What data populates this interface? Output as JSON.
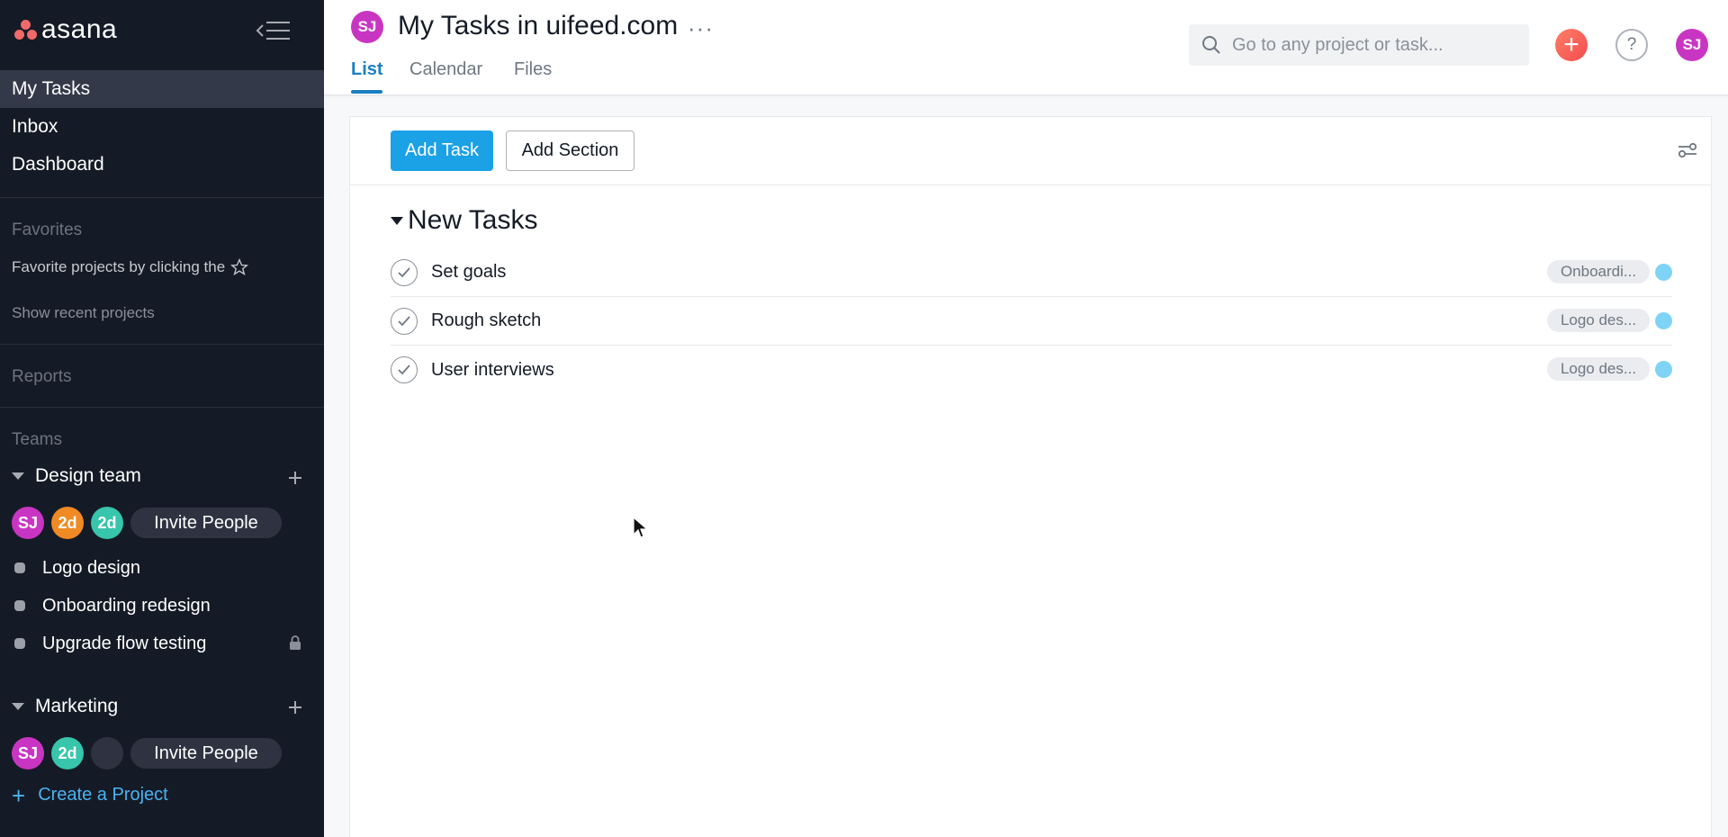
{
  "app": {
    "logo_text": "asana"
  },
  "sidebar": {
    "nav": [
      {
        "label": "My Tasks",
        "active": true
      },
      {
        "label": "Inbox"
      },
      {
        "label": "Dashboard"
      }
    ],
    "favorites_heading": "Favorites",
    "favorites_hint": "Favorite projects by clicking the",
    "show_recent": "Show recent projects",
    "reports_heading": "Reports",
    "teams_heading": "Teams",
    "teams": [
      {
        "name": "Design team",
        "members": [
          {
            "initials": "SJ",
            "color": "#c935c3"
          },
          {
            "initials": "2d",
            "color": "#f08a24"
          },
          {
            "initials": "2d",
            "color": "#37c5ab"
          }
        ],
        "invite_label": "Invite People",
        "projects": [
          {
            "name": "Logo design",
            "locked": false
          },
          {
            "name": "Onboarding redesign",
            "locked": false
          },
          {
            "name": "Upgrade flow testing",
            "locked": true
          }
        ]
      },
      {
        "name": "Marketing",
        "members": [
          {
            "initials": "SJ",
            "color": "#c935c3"
          },
          {
            "initials": "2d",
            "color": "#37c5ab"
          },
          {
            "initials": "",
            "color": "#2f3341"
          }
        ],
        "invite_label": "Invite People",
        "projects": []
      }
    ],
    "create_project": "Create a Project"
  },
  "header": {
    "avatar_initials": "SJ",
    "title": "My Tasks in uifeed.com",
    "more": "···",
    "tabs": [
      {
        "label": "List",
        "active": true
      },
      {
        "label": "Calendar"
      },
      {
        "label": "Files"
      }
    ],
    "search_placeholder": "Go to any project or task...",
    "add_symbol": "+",
    "help_symbol": "?",
    "user_initials": "SJ"
  },
  "toolbar": {
    "add_task": "Add Task",
    "add_section": "Add Section"
  },
  "section": {
    "title": "New Tasks",
    "tasks": [
      {
        "name": "Set goals",
        "project": "Onboardi...",
        "project_color": "#7ed3f6"
      },
      {
        "name": "Rough sketch",
        "project": "Logo des...",
        "project_color": "#7ed3f6"
      },
      {
        "name": "User interviews",
        "project": "Logo des...",
        "project_color": "#7ed3f6"
      }
    ]
  },
  "colors": {
    "sidebar_bg": "#151b26",
    "accent_blue": "#1aa1e6",
    "tab_active": "#1a7fc1",
    "brand_coral": "#f06a6a"
  }
}
